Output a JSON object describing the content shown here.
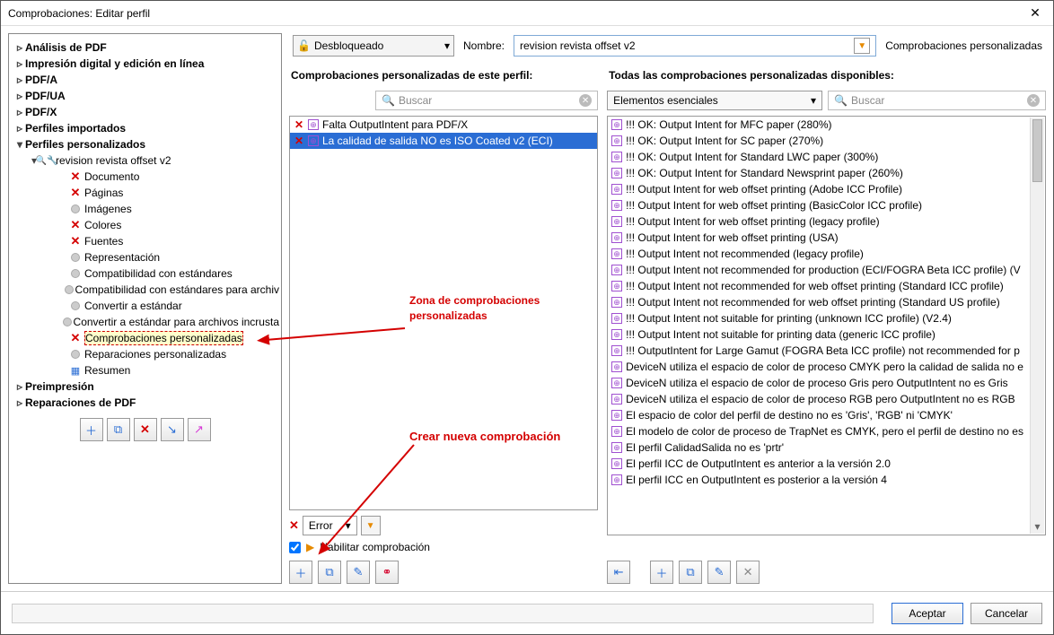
{
  "window": {
    "title": "Comprobaciones: Editar perfil"
  },
  "tree": {
    "top": [
      "Análisis de PDF",
      "Impresión digital y edición en línea",
      "PDF/A",
      "PDF/UA",
      "PDF/X",
      "Perfiles importados"
    ],
    "custom_root": "Perfiles personalizados",
    "profile_name": "revision revista offset v2",
    "children": [
      {
        "label": "Documento",
        "icon": "x"
      },
      {
        "label": "Páginas",
        "icon": "x"
      },
      {
        "label": "Imágenes",
        "icon": "dot"
      },
      {
        "label": "Colores",
        "icon": "x"
      },
      {
        "label": "Fuentes",
        "icon": "x"
      },
      {
        "label": "Representación",
        "icon": "dot"
      },
      {
        "label": "Compatibilidad con estándares",
        "icon": "dot"
      },
      {
        "label": "Compatibilidad con estándares para archiv",
        "icon": "dot"
      },
      {
        "label": "Convertir a estándar",
        "icon": "dot"
      },
      {
        "label": "Convertir a estándar para archivos incrusta",
        "icon": "dot"
      },
      {
        "label": "Comprobaciones personalizadas",
        "icon": "x",
        "sel": true
      },
      {
        "label": "Reparaciones personalizadas",
        "icon": "dot"
      },
      {
        "label": "Resumen",
        "icon": "sum"
      }
    ],
    "bottom": [
      "Preimpresión",
      "Reparaciones de PDF"
    ]
  },
  "toolbar": {
    "lock_label": "Desbloqueado",
    "name_label": "Nombre:",
    "top_right": "Comprobaciones personalizadas"
  },
  "name_value": "revision revista offset v2",
  "left_col": {
    "header": "Comprobaciones personalizadas de este perfil:",
    "search_placeholder": "Buscar",
    "items": [
      "Falta OutputIntent para PDF/X",
      "La calidad de salida NO es ISO Coated v2 (ECI)"
    ],
    "error_label": "Error",
    "enable_label": "Habilitar comprobación"
  },
  "right_col": {
    "header": "Todas las comprobaciones personalizadas disponibles:",
    "dropdown_value": "Elementos esenciales",
    "search_placeholder": "Buscar",
    "items": [
      "!!! OK: Output Intent for MFC paper (280%)",
      "!!! OK: Output Intent for SC paper (270%)",
      "!!! OK: Output Intent for Standard LWC paper (300%)",
      "!!! OK: Output Intent for Standard Newsprint paper (260%)",
      "!!! Output Intent for web offset printing (Adobe ICC Profile)",
      "!!! Output Intent for web offset printing (BasicColor ICC profile)",
      "!!! Output Intent for web offset printing (legacy profile)",
      "!!! Output Intent for web offset printing (USA)",
      "!!! Output Intent not recommended (legacy profile)",
      "!!! Output Intent not recommended for production (ECI/FOGRA Beta ICC profile) (V",
      "!!! Output Intent not recommended for web offset printing (Standard ICC profile)",
      "!!! Output Intent not recommended for web offset printing (Standard US profile)",
      "!!! Output Intent not suitable for printing (unknown ICC profile) (V2.4)",
      "!!! Output Intent not suitable for printing data (generic ICC profile)",
      "!!! OutputIntent for Large Gamut (FOGRA Beta ICC profile) not recommended for p",
      "DeviceN utiliza el espacio de color de proceso CMYK pero la calidad de salida no e",
      "DeviceN utiliza el espacio de color de proceso Gris pero OutputIntent no es Gris",
      "DeviceN utiliza el espacio de color de proceso RGB pero OutputIntent no es RGB",
      "El espacio de color del perfil de destino no es 'Gris', 'RGB' ni 'CMYK'",
      "El modelo de color de proceso de TrapNet es CMYK, pero el perfil de destino no es",
      "El perfil CalidadSalida no es 'prtr'",
      "El perfil ICC de OutputIntent es anterior a la versión 2.0",
      "El perfil ICC en OutputIntent es posterior a la versión 4"
    ]
  },
  "annotations": {
    "zone": "Zona de comprobaciones personalizadas",
    "create": "Crear nueva comprobación"
  },
  "footer": {
    "ok": "Aceptar",
    "cancel": "Cancelar"
  }
}
